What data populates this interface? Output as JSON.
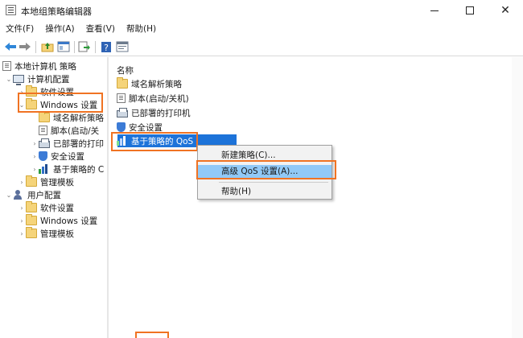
{
  "window": {
    "title": "本地组策略编辑器",
    "controls": {
      "minimize": "",
      "maximize": "",
      "close": "✕"
    }
  },
  "menubar": {
    "items": [
      {
        "label": "文件(F)"
      },
      {
        "label": "操作(A)"
      },
      {
        "label": "查看(V)"
      },
      {
        "label": "帮助(H)"
      }
    ]
  },
  "toolbar": {
    "back_icon": "back-arrow-icon",
    "forward_icon": "forward-arrow-icon",
    "up_icon": "folder-up-icon",
    "console_icon": "show-hide-console-tree-icon",
    "export_icon": "export-list-icon",
    "help_icon": "help-icon",
    "properties_icon": "properties-icon"
  },
  "tree": {
    "root": "本地计算机 策略",
    "computer_config": "计算机配置",
    "software_settings": "软件设置",
    "windows_settings": "Windows 设置",
    "dns_policy": "域名解析策略",
    "scripts": "脚本(启动/关",
    "deployed_printers": "已部署的打印",
    "security_settings": "安全设置",
    "qos_policy": "基于策略的 C",
    "admin_templates": "管理模板",
    "user_config": "用户配置",
    "user_software_settings": "软件设置",
    "user_windows_settings": "Windows 设置",
    "user_admin_templates": "管理模板"
  },
  "content": {
    "column_name": "名称",
    "items": [
      {
        "label": "域名解析策略",
        "icon": "folder-icon"
      },
      {
        "label": "脚本(启动/关机)",
        "icon": "script-icon"
      },
      {
        "label": "已部署的打印机",
        "icon": "printer-icon"
      },
      {
        "label": "安全设置",
        "icon": "security-icon"
      },
      {
        "label": "基于策略的 QoS",
        "icon": "qos-chart-icon"
      }
    ]
  },
  "context_menu": {
    "new_policy": "新建策略(C)...",
    "advanced_qos": "高级 QoS 设置(A)...",
    "help": "帮助(H)"
  },
  "colors": {
    "highlight_border": "#f07323",
    "selection": "#1d73d9",
    "menu_hover": "#91c9f7"
  }
}
